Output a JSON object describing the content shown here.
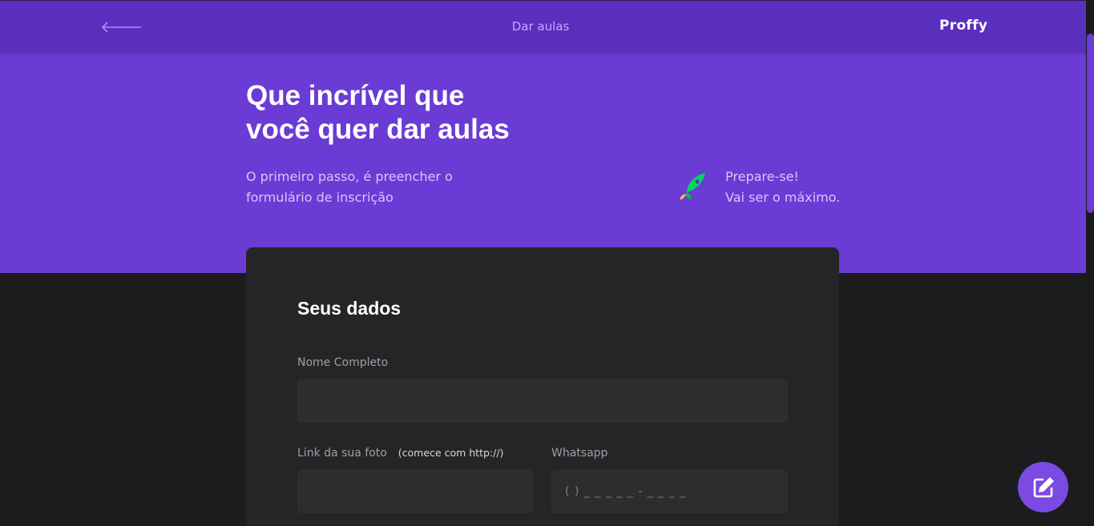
{
  "header": {
    "back_icon": "arrow-left-icon",
    "title": "Dar aulas",
    "logo_text": "Proffy"
  },
  "hero": {
    "title_line1": "Que incrível que",
    "title_line2": "você quer dar aulas",
    "description_line1": "O primeiro passo, é preencher o",
    "description_line2": "formulário de inscrição",
    "note_icon": "rocket-icon",
    "note_line1": "Prepare-se!",
    "note_line2": "Vai ser o máximo."
  },
  "form": {
    "section_title": "Seus dados",
    "name_label": "Nome Completo",
    "name_value": "",
    "photo_label": "Link da sua foto",
    "photo_hint": "(comece com http://)",
    "photo_value": "",
    "whatsapp_label": "Whatsapp",
    "whatsapp_value": "( ) _ _ _ _ _ - _ _ _ _"
  },
  "fab": {
    "icon": "edit-icon"
  },
  "colors": {
    "header_bg": "#5a2fbd",
    "hero_bg": "#6a3bd5",
    "page_bg": "#1c1c1e",
    "card_bg": "#252527",
    "input_bg": "#2d2d30",
    "accent": "#7a4ae2"
  }
}
